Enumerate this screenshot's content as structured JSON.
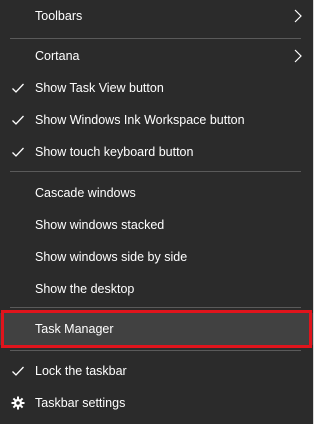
{
  "menu": {
    "toolbars": "Toolbars",
    "cortana": "Cortana",
    "show_task_view": "Show Task View button",
    "show_ink_workspace": "Show Windows Ink Workspace button",
    "show_touch_keyboard": "Show touch keyboard button",
    "cascade_windows": "Cascade windows",
    "show_windows_stacked": "Show windows stacked",
    "show_windows_side_by_side": "Show windows side by side",
    "show_desktop": "Show the desktop",
    "task_manager": "Task Manager",
    "lock_taskbar": "Lock the taskbar",
    "taskbar_settings": "Taskbar settings"
  },
  "colors": {
    "menu_bg": "#2b2b2b",
    "highlight_bg": "#414141",
    "highlight_border": "#e0141c",
    "separator": "#5a5a5a",
    "text": "#ffffff"
  },
  "icons": {
    "submenu": "chevron-right-icon",
    "checked": "checkmark-icon",
    "settings": "gear-icon"
  }
}
